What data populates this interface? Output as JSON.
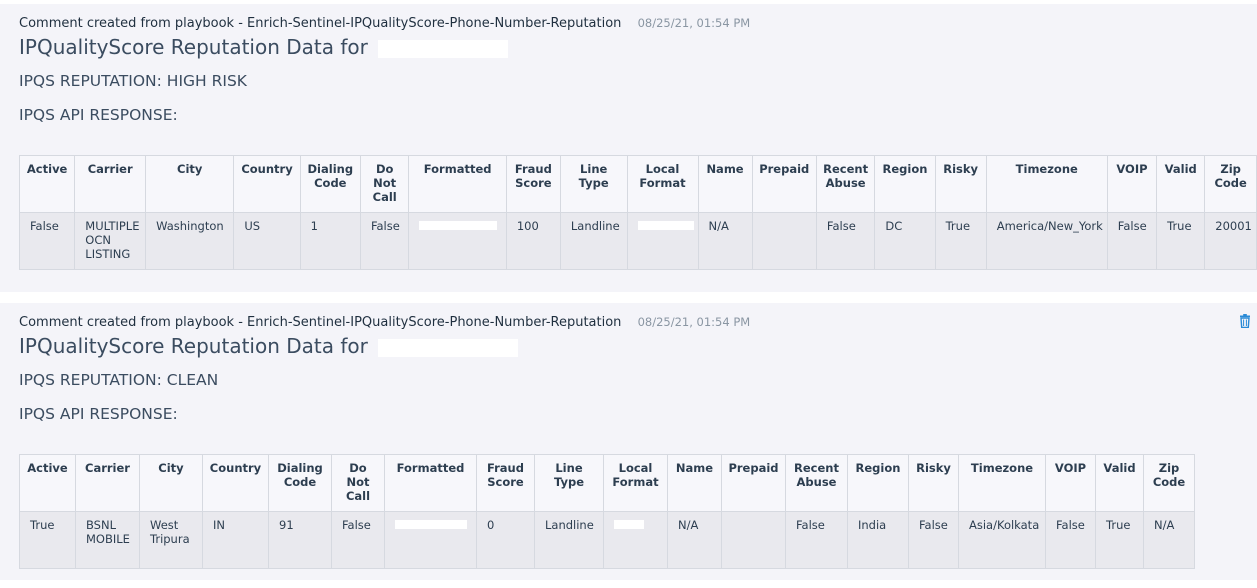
{
  "comments": [
    {
      "meta": "Comment created from playbook - Enrich-Sentinel-IPQualityScore-Phone-Number-Reputation",
      "time": "08/25/21, 01:54 PM",
      "title": "IPQualityScore Reputation Data for",
      "reputation": "IPQS REPUTATION: HIGH RISK",
      "api_label": "IPQS API RESPONSE:",
      "headers": [
        "Active",
        "Carrier",
        "City",
        "Country",
        "Dialing Code",
        "Do Not Call",
        "Formatted",
        "Fraud Score",
        "Line Type",
        "Local Format",
        "Name",
        "Prepaid",
        "Recent Abuse",
        "Region",
        "Risky",
        "Timezone",
        "VOIP",
        "Valid",
        "Zip Code"
      ],
      "row": [
        "False",
        "MULTIPLE OCN LISTING",
        "Washington",
        "US",
        "1",
        "False",
        "",
        "100",
        "Landline",
        "",
        "N/A",
        "",
        "False",
        "DC",
        "True",
        "America/New_York",
        "False",
        "True",
        "20001"
      ]
    },
    {
      "meta": "Comment created from playbook - Enrich-Sentinel-IPQualityScore-Phone-Number-Reputation",
      "time": "08/25/21, 01:54 PM",
      "title": "IPQualityScore Reputation Data for",
      "reputation": "IPQS REPUTATION: CLEAN",
      "api_label": "IPQS API RESPONSE:",
      "headers": [
        "Active",
        "Carrier",
        "City",
        "Country",
        "Dialing Code",
        "Do Not Call",
        "Formatted",
        "Fraud Score",
        "Line Type",
        "Local Format",
        "Name",
        "Prepaid",
        "Recent Abuse",
        "Region",
        "Risky",
        "Timezone",
        "VOIP",
        "Valid",
        "Zip Code"
      ],
      "row": [
        "True",
        "BSNL MOBILE",
        "West Tripura",
        "IN",
        "91",
        "False",
        "",
        "0",
        "Landline",
        "",
        "N/A",
        "",
        "False",
        "India",
        "False",
        "Asia/Kolkata",
        "False",
        "True",
        "N/A"
      ]
    }
  ],
  "icons": {
    "delete": "trash-icon"
  },
  "colors": {
    "accent": "#2a8ad6",
    "panel": "#f4f4f9",
    "cell": "#e9e9ee"
  }
}
